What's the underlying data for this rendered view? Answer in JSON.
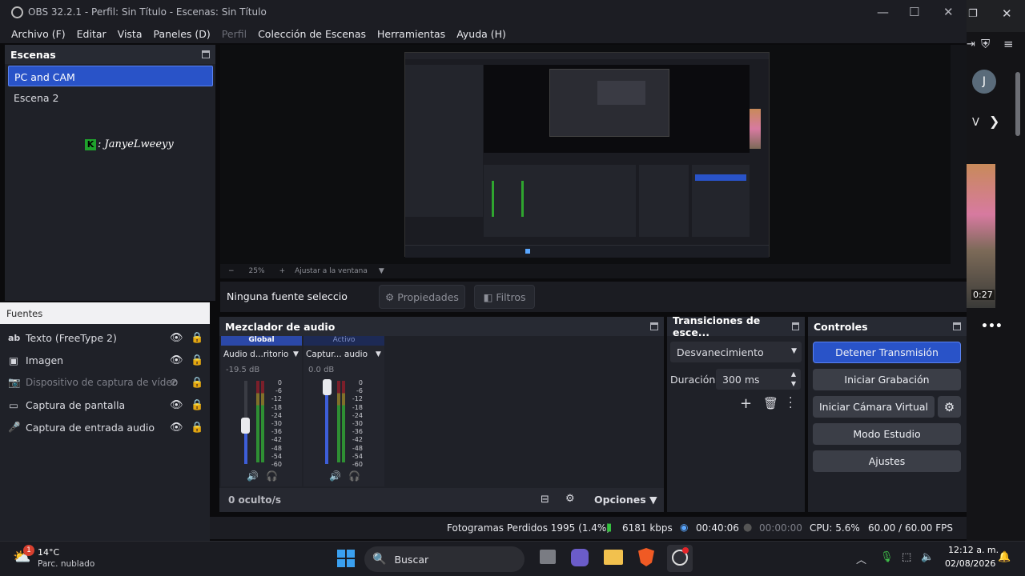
{
  "window": {
    "title": "OBS 32.2.1 - Perfil: Sin Título - Escenas: Sin Título"
  },
  "menu": [
    "Archivo (F)",
    "Editar",
    "Vista",
    "Paneles (D)",
    "Perfil",
    "Colección de Escenas",
    "Herramientas",
    "Ayuda (H)"
  ],
  "scenes": {
    "title": "Escenas",
    "items": [
      "PC and CAM",
      "Escena 2"
    ],
    "overlay_text": ": JanyeLweeyy"
  },
  "preview": {
    "zoom": "25%",
    "fit_label": "Ajustar a la ventana"
  },
  "source_bar": {
    "selected": "Ninguna fuente seleccionad",
    "properties": "Propiedades",
    "filters": "Filtros"
  },
  "sources": {
    "title": "Fuentes",
    "items": [
      {
        "label": "Texto (FreeType 2)",
        "icon": "text-icon"
      },
      {
        "label": "Imagen",
        "icon": "image-icon"
      },
      {
        "label": "Dispositivo de captura de vídeo",
        "icon": "camera-icon"
      },
      {
        "label": "Captura de pantalla",
        "icon": "monitor-icon"
      },
      {
        "label": "Captura de entrada audio",
        "icon": "microphone-icon"
      }
    ]
  },
  "mixer": {
    "title": "Mezclador de audio",
    "tab_global": "Global",
    "tab_active": "Activo",
    "channels": [
      {
        "name": "Audio d...ritorio",
        "db": "-19.5 dB",
        "fader": 0.35
      },
      {
        "name": "Captur... audio",
        "db": "0.0 dB",
        "fader": 1.0
      }
    ],
    "scale": [
      "0",
      "-6",
      "-12",
      "-18",
      "-24",
      "-30",
      "-36",
      "-42",
      "-48",
      "-54",
      "-60"
    ],
    "hidden": "0 oculto/s",
    "options": "Opciones"
  },
  "transitions": {
    "title": "Transiciones de esce...",
    "selected": "Desvanecimiento",
    "duration_label": "Duración",
    "duration": "300 ms"
  },
  "controls": {
    "title": "Controles",
    "stop_stream": "Detener Transmisión",
    "start_record": "Iniciar Grabación",
    "start_vcam": "Iniciar Cámara Virtual",
    "studio": "Modo Estudio",
    "settings": "Ajustes"
  },
  "status": {
    "dropped": "Fotogramas Perdidos 1995 (1.4%)",
    "bitrate": "6181 kbps",
    "stream_time": "00:40:06",
    "rec_time": "00:00:00",
    "cpu": "CPU: 5.6%",
    "fps": "60.00 / 60.00 FPS"
  },
  "browser_side": {
    "avatar": "J",
    "partial": "V",
    "timestamp": "0:27"
  },
  "taskbar": {
    "weather_temp": "14°C",
    "weather_desc": "Parc. nublado",
    "badge": "1",
    "search": "Buscar",
    "time": "12:12 a. m.",
    "date": "02/08/2026"
  },
  "colors": {
    "accent": "#2953c8",
    "panel": "#1f2128",
    "bg": "#0b0b0d"
  }
}
